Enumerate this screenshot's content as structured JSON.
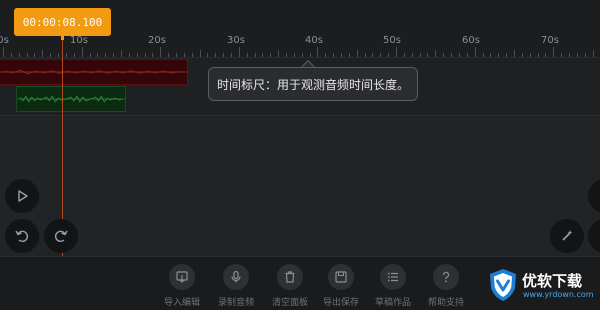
{
  "timecode": "00:00:08.100",
  "ruler": {
    "labels": [
      "0s",
      "10s",
      "20s",
      "30s",
      "40s",
      "50s",
      "60s",
      "70s"
    ]
  },
  "tooltip": "时间标尺：用于观测音频时间长度。",
  "toolbar": {
    "items": [
      {
        "label": "导入编辑",
        "icon": "import-icon"
      },
      {
        "label": "录制音频",
        "icon": "microphone-icon"
      },
      {
        "label": "清空面板",
        "icon": "trash-icon"
      },
      {
        "label": "导出保存",
        "icon": "save-icon"
      },
      {
        "label": "草稿作品",
        "icon": "list-icon"
      },
      {
        "label": "帮助支持",
        "icon": "question-icon"
      }
    ]
  },
  "logo": {
    "name": "优软下载",
    "url": "www.yrdown.com"
  },
  "colors": {
    "accent": "#f29b12",
    "playhead": "#b0491d",
    "clip_red": "#350607",
    "clip_green": "#0c2a12"
  }
}
